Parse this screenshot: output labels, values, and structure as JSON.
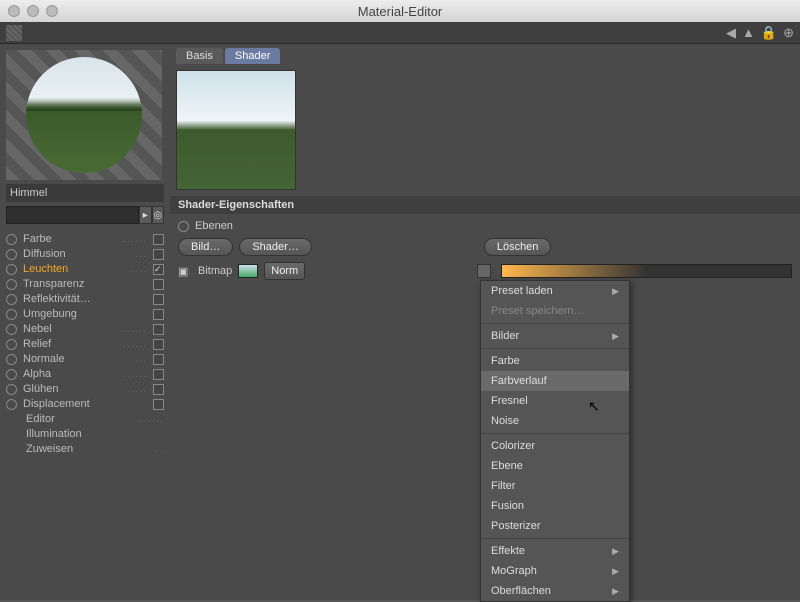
{
  "window": {
    "title": "Material-Editor"
  },
  "material": {
    "name": "Himmel"
  },
  "tabs": {
    "basis": "Basis",
    "shader": "Shader"
  },
  "channels": [
    {
      "label": "Farbe",
      "checked": false,
      "active": false,
      "radio": true
    },
    {
      "label": "Diffusion",
      "checked": false,
      "active": false,
      "radio": true
    },
    {
      "label": "Leuchten",
      "checked": true,
      "active": true,
      "radio": true
    },
    {
      "label": "Transparenz",
      "checked": false,
      "active": false,
      "radio": true
    },
    {
      "label": "Reflektivität…",
      "checked": false,
      "active": false,
      "radio": true
    },
    {
      "label": "Umgebung",
      "checked": false,
      "active": false,
      "radio": true
    },
    {
      "label": "Nebel",
      "checked": false,
      "active": false,
      "radio": true
    },
    {
      "label": "Relief",
      "checked": false,
      "active": false,
      "radio": true
    },
    {
      "label": "Normale",
      "checked": false,
      "active": false,
      "radio": true
    },
    {
      "label": "Alpha",
      "checked": false,
      "active": false,
      "radio": true
    },
    {
      "label": "Glühen",
      "checked": false,
      "active": false,
      "radio": true
    },
    {
      "label": "Displacement",
      "checked": false,
      "active": false,
      "radio": true
    }
  ],
  "sub_channels": [
    {
      "label": "Editor"
    },
    {
      "label": "Illumination"
    },
    {
      "label": "Zuweisen"
    }
  ],
  "section": {
    "title": "Shader-Eigenschaften",
    "ebenen": "Ebenen"
  },
  "buttons": {
    "bild": "Bild…",
    "shader": "Shader…",
    "loeschen": "Löschen"
  },
  "layer": {
    "bitmap": "Bitmap",
    "mode": "Norm"
  },
  "menu": {
    "preset_load": "Preset laden",
    "preset_save": "Preset speichern…",
    "bilder": "Bilder",
    "farbe": "Farbe",
    "farbverlauf": "Farbverlauf",
    "fresnel": "Fresnel",
    "noise": "Noise",
    "colorizer": "Colorizer",
    "ebene": "Ebene",
    "filter": "Filter",
    "fusion": "Fusion",
    "posterizer": "Posterizer",
    "effekte": "Effekte",
    "mograph": "MoGraph",
    "oberflaechen": "Oberflächen"
  }
}
